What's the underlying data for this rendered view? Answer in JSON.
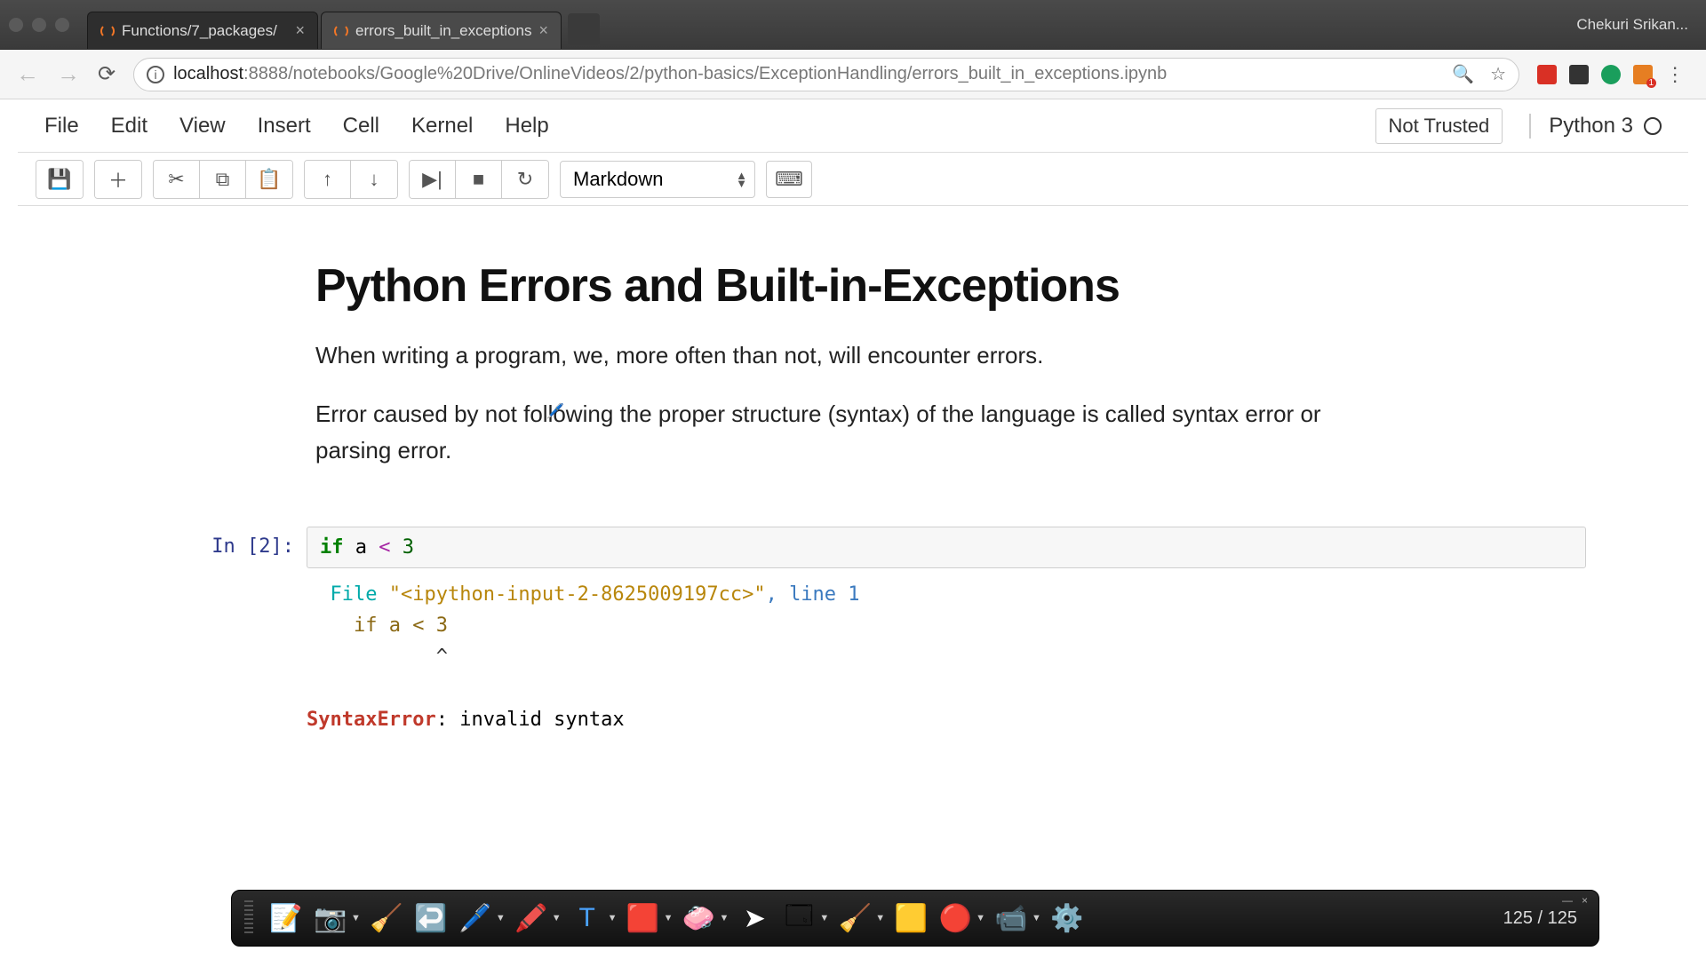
{
  "browser": {
    "tabs": [
      {
        "title": "Functions/7_packages/"
      },
      {
        "title": "errors_built_in_exceptions"
      }
    ],
    "user": "Chekuri Srikan...",
    "url_host": "localhost",
    "url_port": ":8888",
    "url_path": "/notebooks/Google%20Drive/OnlineVideos/2/python-basics/ExceptionHandling/errors_built_in_exceptions.ipynb",
    "ext_badge": "1"
  },
  "menubar": {
    "file": "File",
    "edit": "Edit",
    "view": "View",
    "insert": "Insert",
    "cell": "Cell",
    "kernel": "Kernel",
    "help": "Help",
    "not_trusted": "Not Trusted",
    "kernel_name": "Python 3"
  },
  "toolbar": {
    "cell_type": "Markdown"
  },
  "content": {
    "title": "Python Errors and Built-in-Exceptions",
    "para1": "When writing a program, we, more often than not, will encounter errors.",
    "para2": "Error caused by not following the proper structure (syntax) of the language is called syntax error or parsing error."
  },
  "code": {
    "prompt": "In [2]:",
    "kw": "if",
    "var": " a ",
    "op": "<",
    "num": " 3"
  },
  "output": {
    "file_label": "File ",
    "file_str": "\"<ipython-input-2-8625009197cc>\"",
    "file_line": ", line 1",
    "code_line": "    if a < 3",
    "caret_line": "           ^",
    "err_label": "SyntaxError",
    "err_colon": ": ",
    "err_msg": "invalid syntax"
  },
  "bottombar": {
    "counter": "125 / 125"
  }
}
